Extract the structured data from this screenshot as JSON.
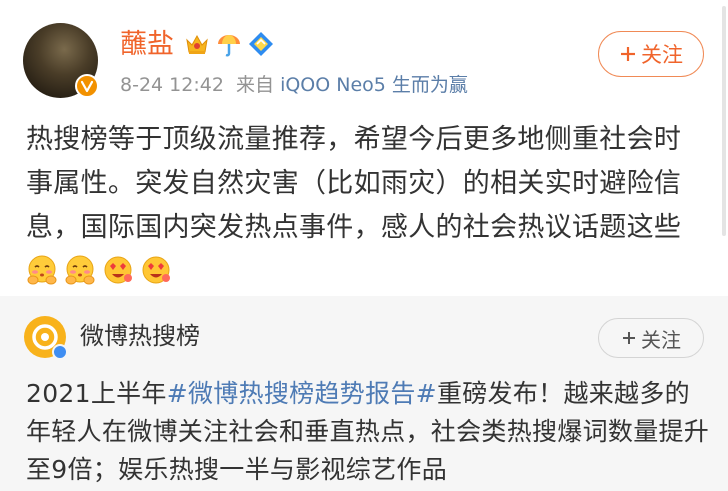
{
  "post": {
    "username": "蘸盐",
    "timestamp": "8-24 12:42",
    "source_prefix": "来自",
    "source_device": "iQOO Neo5 生而为赢",
    "follow_label": "关注",
    "text": "热搜榜等于顶级流量推荐，希望今后更多地侧重社会时事属性。突发自然灾害（比如雨灾）的相关实时避险信息，国际国内突发热点事件，感人的社会热议话题这些",
    "emojis": [
      "blush-hide-emoji",
      "blush-hide-emoji",
      "heart-eyes-emoji",
      "heart-eyes-emoji"
    ],
    "badges": [
      "crown-icon",
      "umbrella-icon",
      "diamond-icon"
    ]
  },
  "repost": {
    "name": "微博热搜榜",
    "follow_label": "关注",
    "text_before": "2021上半年",
    "topic": "#微博热搜榜趋势报告#",
    "text_after": "重磅发布！越来越多的年轻人在微博关注社会和垂直热点，社会类热搜爆词数量提升至9倍；娱乐热搜一半与影视综艺作品"
  },
  "colors": {
    "username": "#f0642b",
    "link": "#4e7bb5",
    "repost_bg": "#f6f6f6"
  }
}
